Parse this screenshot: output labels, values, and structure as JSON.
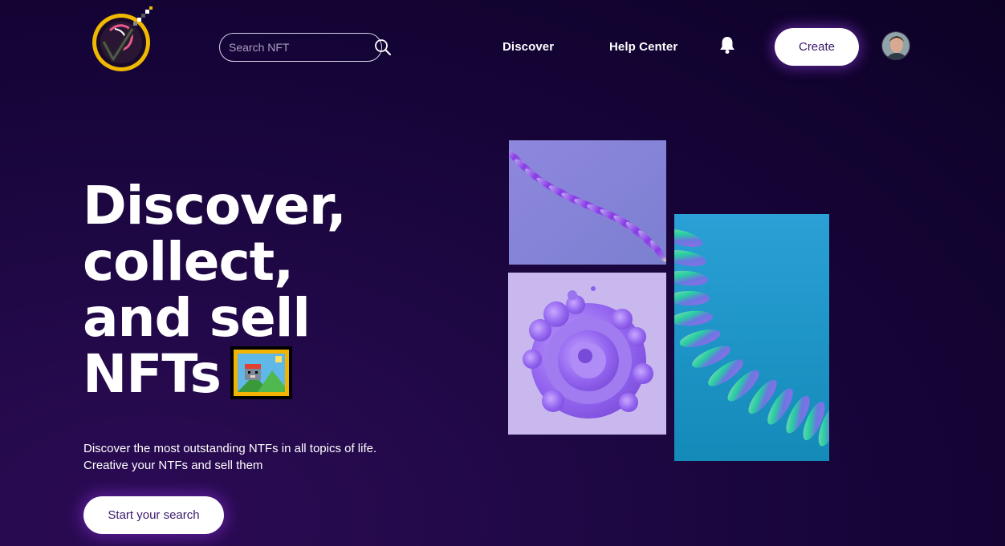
{
  "header": {
    "logo_name": "checkmark-pixel-logo",
    "search": {
      "placeholder": "Search NFT",
      "value": ""
    },
    "nav": [
      {
        "label": "Discover"
      },
      {
        "label": "Help Center"
      }
    ],
    "create_label": "Create"
  },
  "hero": {
    "title_lines": [
      "Discover,",
      "collect,",
      "and sell",
      "NFTs"
    ],
    "subtitle_lines": [
      "Discover the most outstanding NTFs in all topics of life.",
      "Creative your NTFs and sell them"
    ],
    "cta_label": "Start your search"
  },
  "gallery": [
    {
      "name": "purple-wave-ribbon-art"
    },
    {
      "name": "purple-spiral-blob-art"
    },
    {
      "name": "teal-spiral-ribbon-art"
    }
  ],
  "colors": {
    "background": "#150437",
    "accent": "#7b2fe0",
    "button_text": "#3a1a6a"
  }
}
